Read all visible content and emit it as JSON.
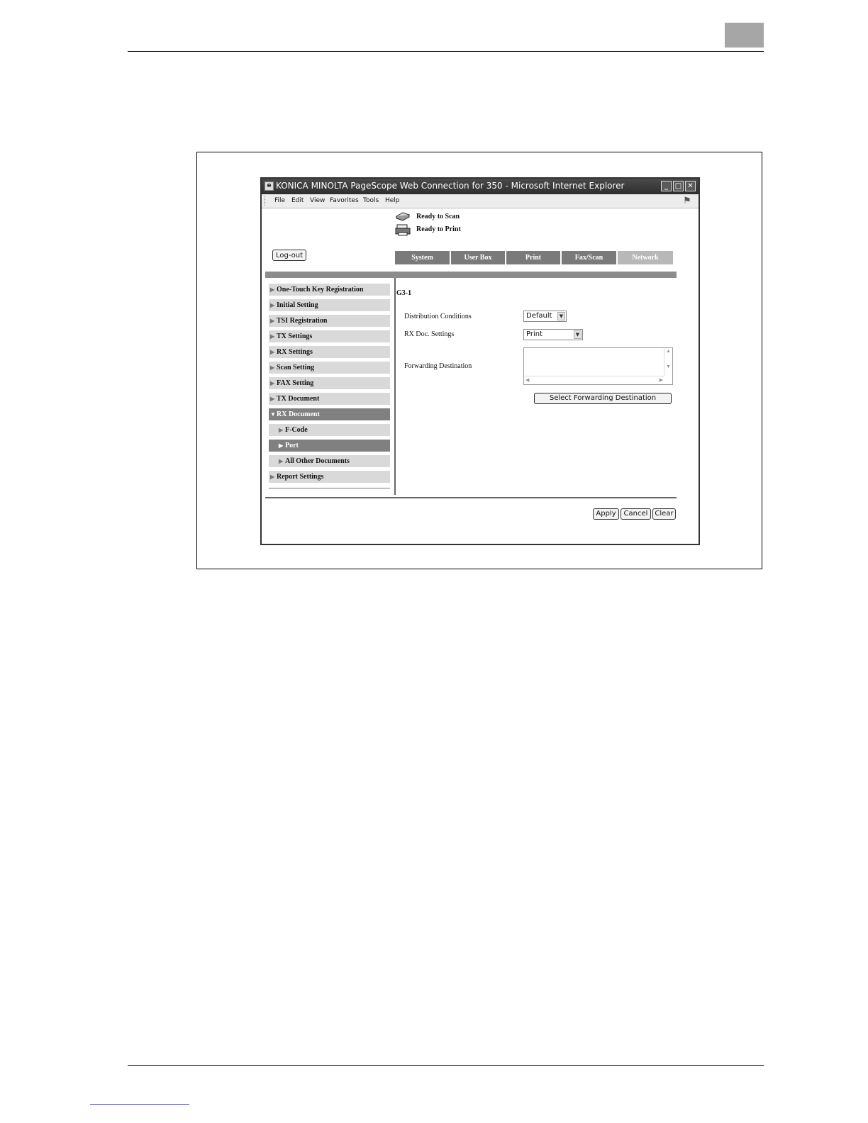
{
  "window": {
    "title": "KONICA MINOLTA PageScope Web Connection for 350 - Microsoft Internet Explorer",
    "controls": {
      "minimize": "_",
      "maximize": "□",
      "close": "✕"
    }
  },
  "menubar": [
    {
      "label": "File"
    },
    {
      "label": "Edit"
    },
    {
      "label": "View"
    },
    {
      "label": "Favorites"
    },
    {
      "label": "Tools"
    },
    {
      "label": "Help"
    }
  ],
  "status": {
    "scan": "Ready to Scan",
    "print": "Ready to Print"
  },
  "logout_label": "Log-out",
  "tabs": [
    {
      "label": "System"
    },
    {
      "label": "User Box"
    },
    {
      "label": "Print"
    },
    {
      "label": "Fax/Scan"
    },
    {
      "label": "Network"
    }
  ],
  "sidebar": [
    {
      "label": "One-Touch Key Registration",
      "arrow": "▶"
    },
    {
      "label": "Initial Setting",
      "arrow": "▶"
    },
    {
      "label": "TSI Registration",
      "arrow": "▶"
    },
    {
      "label": "TX Settings",
      "arrow": "▶"
    },
    {
      "label": "RX Settings",
      "arrow": "▶"
    },
    {
      "label": "Scan Setting",
      "arrow": "▶"
    },
    {
      "label": "FAX Setting",
      "arrow": "▶"
    },
    {
      "label": "TX Document",
      "arrow": "▶"
    },
    {
      "label": "RX Document",
      "arrow": "▼"
    },
    {
      "label": "F-Code",
      "arrow": "▶"
    },
    {
      "label": "Port",
      "arrow": "▶"
    },
    {
      "label": "All Other Documents",
      "arrow": "▶"
    },
    {
      "label": "Report Settings",
      "arrow": "▶"
    }
  ],
  "form": {
    "section_title": "G3-1",
    "distribution_label": "Distribution Conditions",
    "distribution_value": "Default",
    "rx_doc_label": "RX Doc. Settings",
    "rx_doc_value": "Print",
    "forwarding_label": "Forwarding Destination",
    "forwarding_value": "",
    "select_destination_label": "Select Forwarding Destination"
  },
  "footer_buttons": {
    "apply": "Apply",
    "cancel": "Cancel",
    "clear": "Clear"
  },
  "colors": {
    "tab_active": "#7a7a7a",
    "tab_network": "#b8b8b8",
    "sidebar_selected": "#808080",
    "sidebar_item": "#d9d9d9"
  }
}
